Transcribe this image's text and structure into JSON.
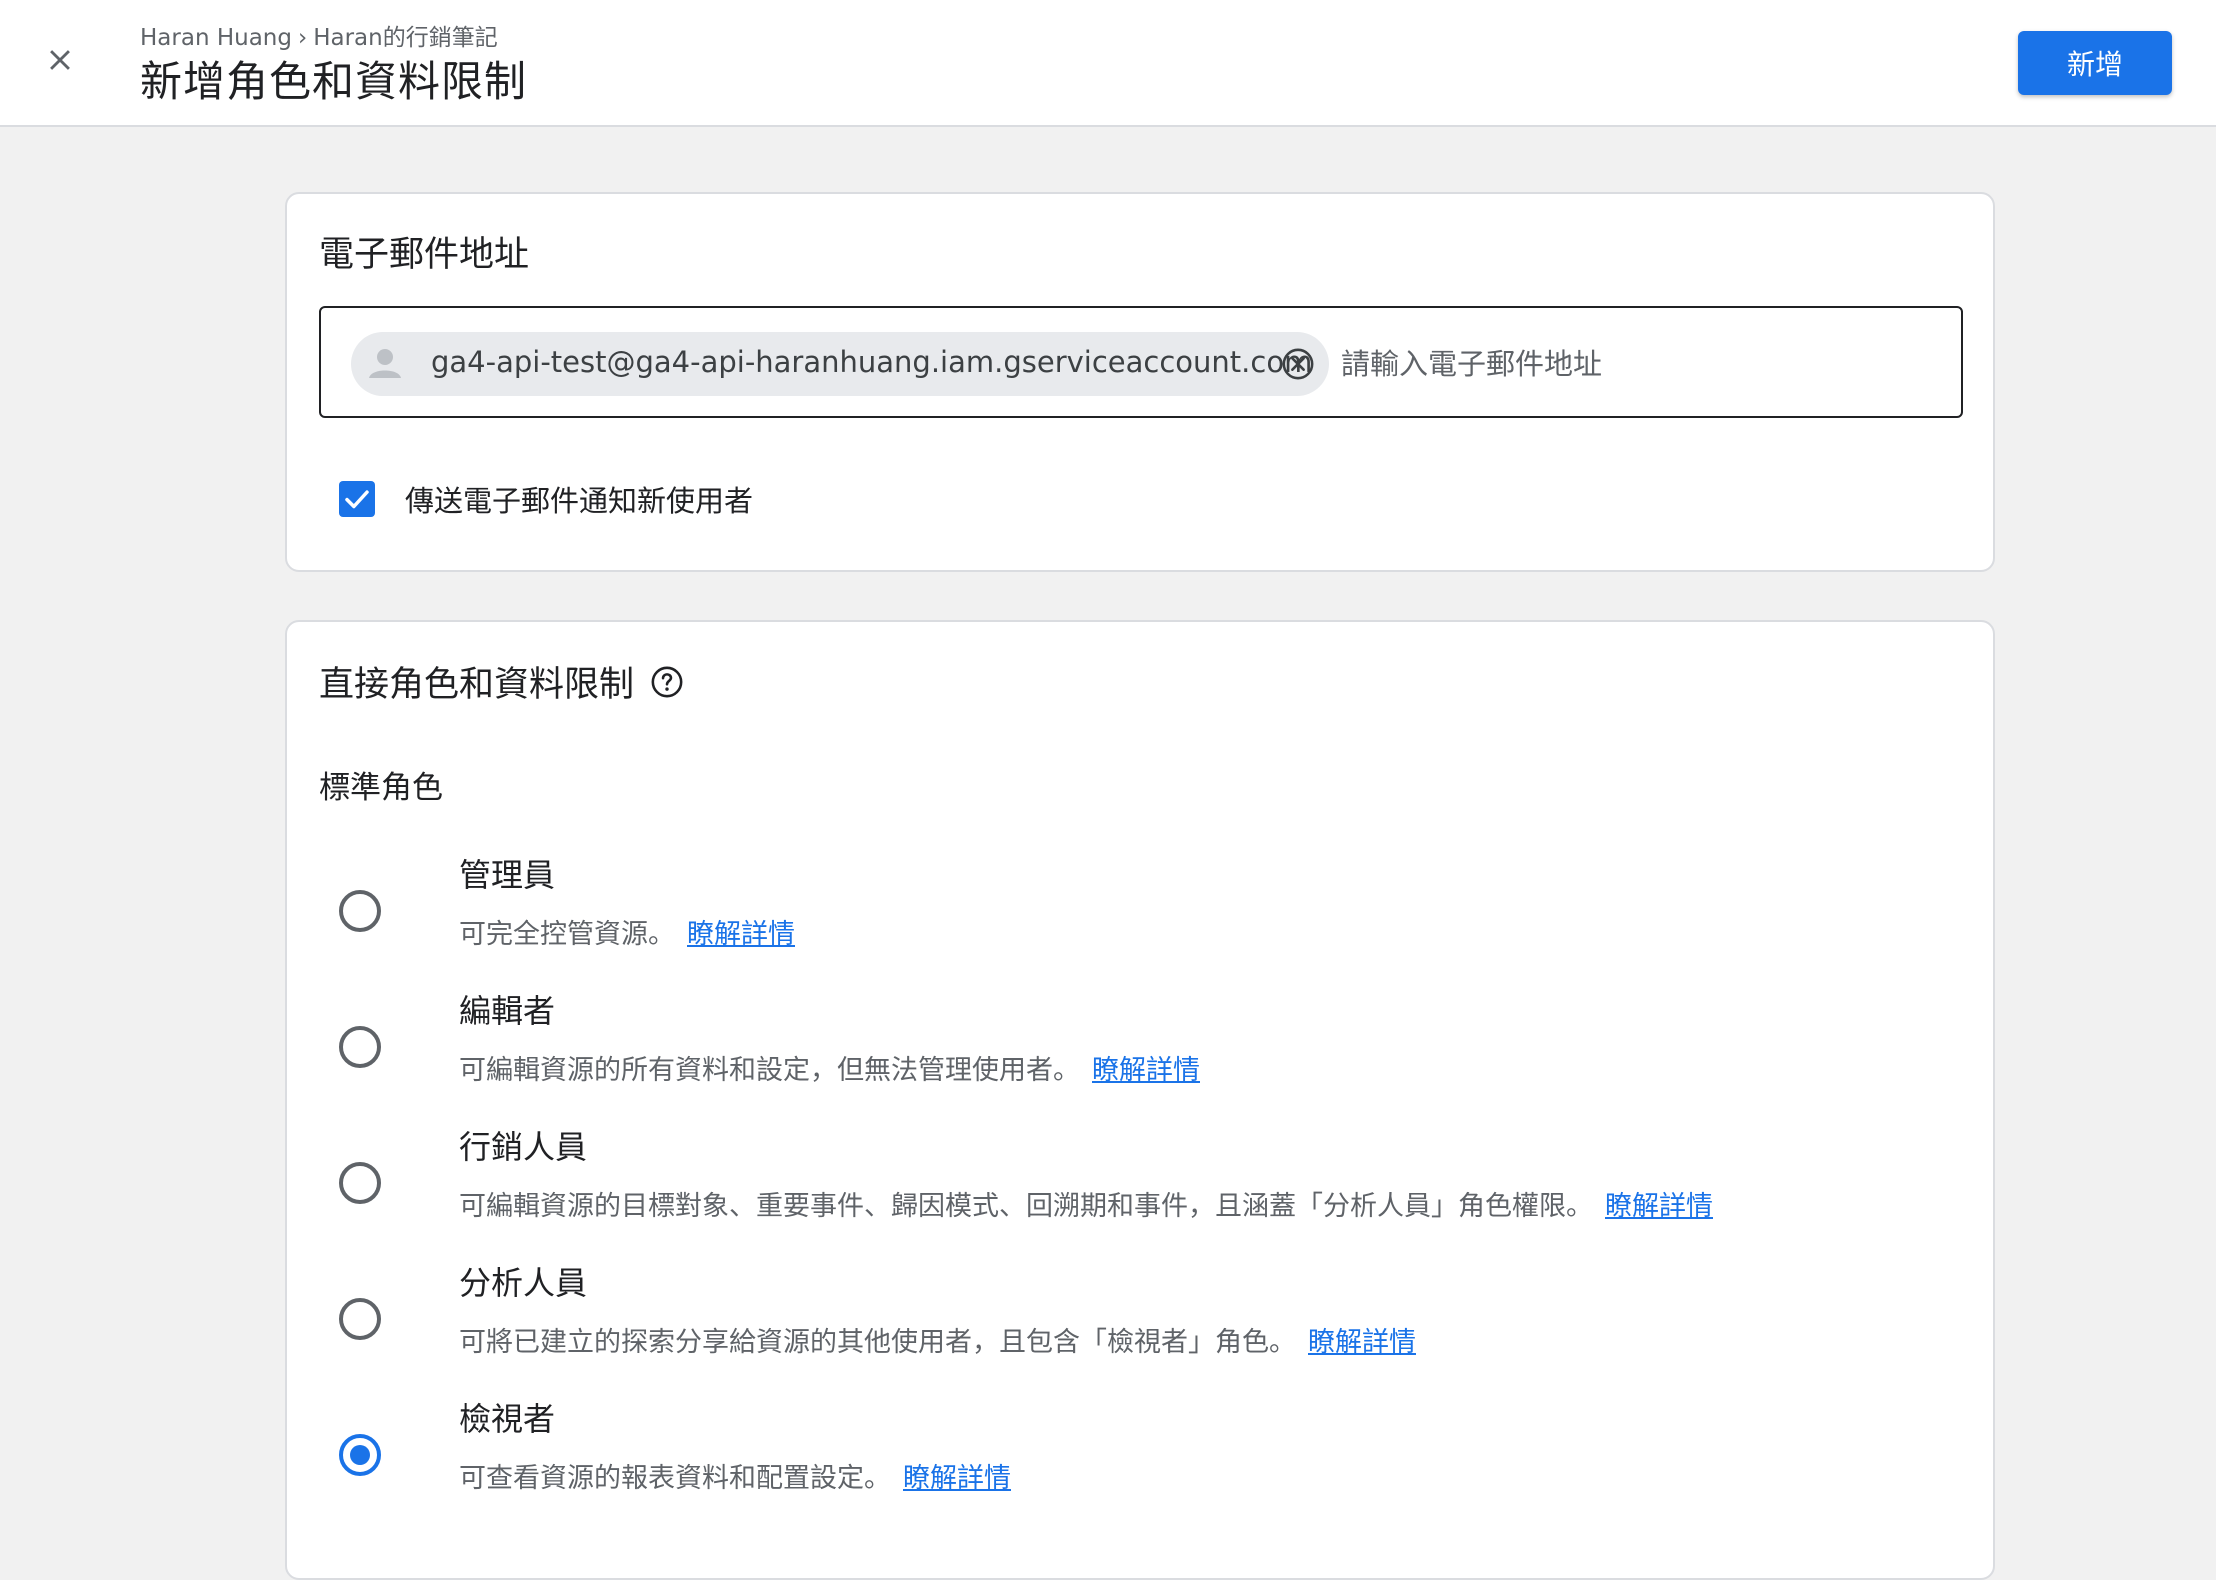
{
  "header": {
    "breadcrumb": {
      "account": "Haran Huang",
      "separator": "›",
      "property": "Haran的行銷筆記"
    },
    "title": "新增角色和資料限制",
    "add_label": "新增"
  },
  "email_section": {
    "title": "電子郵件地址",
    "chip_email": "ga4-api-test@ga4-api-haranhuang.iam.gserviceaccount.com",
    "placeholder": "請輸入電子郵件地址",
    "notify_label": "傳送電子郵件通知新使用者",
    "notify_checked": true
  },
  "roles_section": {
    "title": "直接角色和資料限制",
    "standard_label": "標準角色",
    "learn_more": "瞭解詳情",
    "roles": [
      {
        "name": "管理員",
        "desc": "可完全控管資源。",
        "selected": false
      },
      {
        "name": "編輯者",
        "desc": "可編輯資源的所有資料和設定，但無法管理使用者。",
        "selected": false
      },
      {
        "name": "行銷人員",
        "desc": "可編輯資源的目標對象、重要事件、歸因模式、回溯期和事件，且涵蓋「分析人員」角色權限。",
        "selected": false
      },
      {
        "name": "分析人員",
        "desc": "可將已建立的探索分享給資源的其他使用者，且包含「檢視者」角色。",
        "selected": false
      },
      {
        "name": "檢視者",
        "desc": "可查看資源的報表資料和配置設定。",
        "selected": true
      }
    ]
  },
  "colors": {
    "accent": "#1a73e8",
    "background": "#f1f1f1",
    "chip": "#e8eaed"
  }
}
